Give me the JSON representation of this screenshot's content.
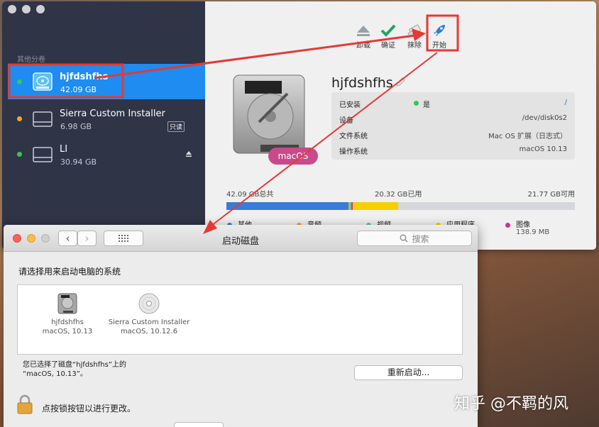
{
  "sidebar": {
    "section_label": "其他分卷",
    "volumes": [
      {
        "name": "hjfdshfhs",
        "size": "42.09 GB",
        "status_color": "#34c759",
        "selected": true
      },
      {
        "name": "Sierra Custom Installer",
        "size": "6.98 GB",
        "status_color": "#f5a623",
        "badge": "只读"
      },
      {
        "name": "LI",
        "size": "30.94 GB",
        "status_color": "#34c759",
        "eject_icon": "eject-icon"
      }
    ]
  },
  "toolbar": {
    "unmount_label": "卸载",
    "verify_label": "确证",
    "erase_label": "抹除",
    "start_label": "开始"
  },
  "disk": {
    "title": "hjfdshfhs",
    "hdd_label": "macOS",
    "info": {
      "installed_key": "已安装",
      "installed_val": "是",
      "mount_val": "/",
      "device_key": "设备",
      "device_val": "/dev/disk0s2",
      "fs_key": "文件系统",
      "fs_val": "Mac OS 扩展（日志式）",
      "os_key": "操作系统",
      "os_val": "macOS 10.13"
    }
  },
  "usage": {
    "total": "42.09 GB总共",
    "used": "20.32 GB已用",
    "free": "21.77 GB可用",
    "segments_fraction": {
      "other": 0.35,
      "audio": 0.005,
      "video": 0.003,
      "apps": 0.13,
      "images": 0.003
    },
    "legend": [
      {
        "label": "其他",
        "color": "#3a7bd5"
      },
      {
        "label": "音频",
        "color": "#f5a623"
      },
      {
        "label": "视频",
        "color": "#5ac8a8"
      },
      {
        "label": "应用程序",
        "color": "#f4d000"
      },
      {
        "label": "图像",
        "color": "#d0338a",
        "sub": "138.9 MB"
      }
    ]
  },
  "startup_disk": {
    "window_title": "启动磁盘",
    "search_placeholder": "搜索",
    "heading": "请选择用来启动电脑的系统",
    "items": [
      {
        "name": "hjfdshfhs",
        "os": "macOS, 10.13"
      },
      {
        "name": "Sierra Custom Installer",
        "os": "macOS, 10.12.6"
      }
    ],
    "note_line1": "您已选择了磁盘“hjfdshfhs”上的",
    "note_line2": "“macOS, 10.13”。",
    "restart_label": "重新启动...",
    "lock_text": "点按锁按钮以进行更改。"
  },
  "watermark": "知乎 @不羁的风",
  "colors": {
    "sidebar_bg": "#2f3446",
    "selection": "#1e8cf0",
    "annotation_red": "#e53935"
  }
}
